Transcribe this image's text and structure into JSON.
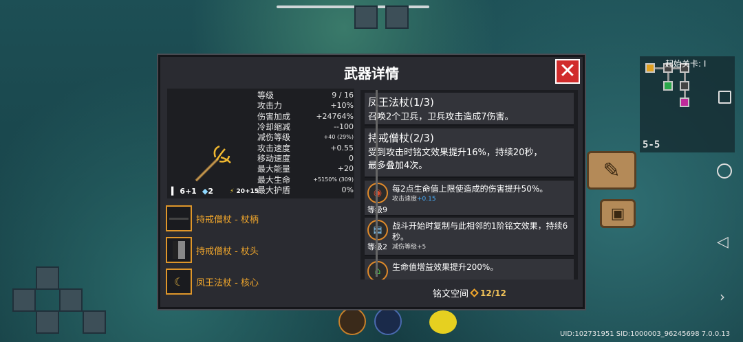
{
  "dialog": {
    "title": "武器详情",
    "close_label": "✕"
  },
  "weapon": {
    "stats": [
      {
        "label": "等级",
        "value": "9 / 16",
        "small": false
      },
      {
        "label": "攻击力",
        "value": "+10%",
        "small": false
      },
      {
        "label": "伤害加成",
        "value": "+24764%",
        "small": false
      },
      {
        "label": "冷却缩减",
        "value": "--100",
        "small": false
      },
      {
        "label": "减伤等级",
        "value": "+40 (29%)",
        "small": true
      },
      {
        "label": "攻击速度",
        "value": "+0.55",
        "small": false
      },
      {
        "label": "移动速度",
        "value": "0",
        "small": false
      },
      {
        "label": "最大能量",
        "value": "+20",
        "small": false
      },
      {
        "label": "最大生命",
        "value": "+5150% (309)",
        "small": true
      },
      {
        "label": "最大护盾",
        "value": "0%",
        "small": false
      }
    ],
    "footer": {
      "damage": "6+1",
      "crystal": "2",
      "energy": "20+15"
    }
  },
  "parts": [
    {
      "label": "持戒僧杖 - 杖柄",
      "icon": "staff-handle-icon"
    },
    {
      "label": "持戒僧杖 - 杖头",
      "icon": "staff-head-icon"
    },
    {
      "label": "凤王法杖 - 核心",
      "icon": "phoenix-core-icon"
    }
  ],
  "effects": [
    {
      "title": "凤王法杖(1/3)",
      "lines": [
        "召唤2个卫兵，卫兵攻击造成7伤害。"
      ]
    },
    {
      "title": "持戒僧杖(2/3)",
      "lines": [
        "受到攻击时铭文效果提升16%，持续20秒，",
        "最多叠加4次。"
      ]
    }
  ],
  "inscriptions": [
    {
      "badge": "1",
      "level": "等级9",
      "desc": "每2点生命值上限使造成的伤害提升50%。",
      "sub_label": "攻击速度",
      "sub_value": "+0.15"
    },
    {
      "badge": "3",
      "level": "等级2",
      "desc": "战斗开始时复制与此相邻的1阶铭文效果，持续6秒。",
      "sub_label": "减伤等级+5",
      "sub_value": ""
    },
    {
      "badge": "3",
      "level": "",
      "desc": "生命值增益效果提升200%。",
      "sub_label": "",
      "sub_value": ""
    }
  ],
  "slots": {
    "label": "铭文空间",
    "count": "12/12"
  },
  "minimap": {
    "label": "起始关卡: I",
    "level": "5-5"
  },
  "footer_uid": "UID:102731951 SID:1000003_96245698 7.0.0.13",
  "colors": {
    "accent": "#f0a62c",
    "close": "#d12c2c",
    "panel": "#2a2b31"
  }
}
